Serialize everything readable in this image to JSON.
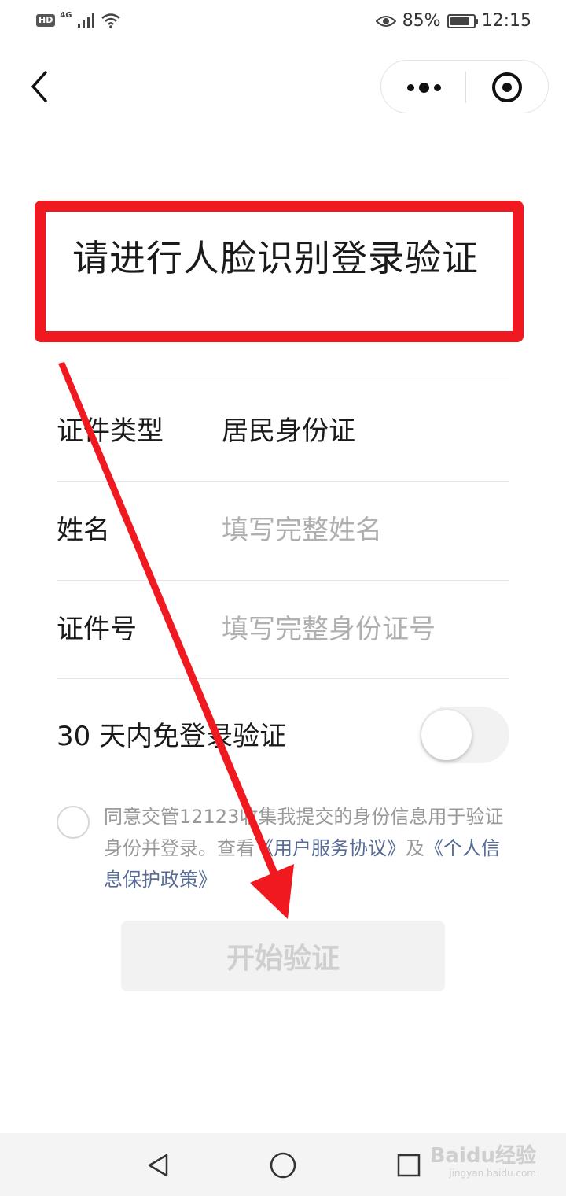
{
  "status_bar": {
    "hd": "HD",
    "network": "4G",
    "battery_percent": "85%",
    "battery_level": 0.85,
    "time": "12:15",
    "icons": [
      "signal-icon",
      "wifi-icon",
      "eye-icon",
      "battery-icon"
    ]
  },
  "nav": {
    "back_icon": "chevron-left-icon",
    "more_icon": "more-dots-icon",
    "close_icon": "target-close-icon"
  },
  "page": {
    "title": "请进行人脸识别登录验证"
  },
  "form": {
    "id_type": {
      "label": "证件类型",
      "value": "居民身份证"
    },
    "name": {
      "label": "姓名",
      "placeholder": "填写完整姓名",
      "value": ""
    },
    "id_number": {
      "label": "证件号",
      "placeholder": "填写完整身份证号",
      "value": ""
    }
  },
  "remember": {
    "label": "30 天内免登录验证",
    "enabled": false
  },
  "agreement": {
    "checked": false,
    "text_prefix": "同意交管12123收集我提交的身份信息用于验证身份并登录。查看",
    "user_agreement_link": "《用户服务协议》",
    "connector": "及",
    "privacy_link": "《个人信息保护政策》"
  },
  "actions": {
    "start_label": "开始验证"
  },
  "system_nav": {
    "back_icon": "triangle-back-icon",
    "home_icon": "circle-home-icon",
    "recents_icon": "square-recents-icon"
  },
  "watermark": {
    "brand": "Baidu经验",
    "url": "jingyan.baidu.com"
  },
  "colors": {
    "highlight_red": "#f0191f",
    "link_blue": "#576b95",
    "placeholder_gray": "#b0b0b0",
    "disabled_button": "#f2f2f2"
  }
}
